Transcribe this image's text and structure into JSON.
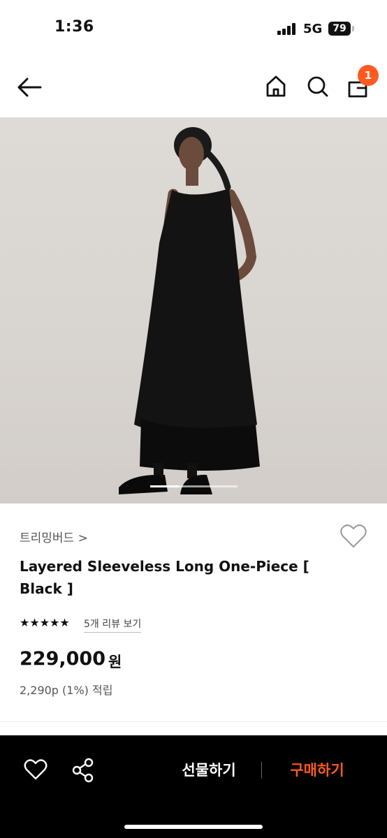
{
  "status_bar": {
    "time": "1:36",
    "network": "5G",
    "battery": "79"
  },
  "nav": {
    "cart_count": "1",
    "accent_color": "#ff5a1f"
  },
  "product": {
    "brand": "트리밍버드 >",
    "title": "Layered Sleeveless Long One-Piece [ Black ]",
    "rating_stars": "★★★★★",
    "rating_value": 5,
    "review_link": "5개 리뷰 보기",
    "price": "229,000",
    "price_unit": "원",
    "points": "2,290p (1%) 적립",
    "image_index": 1,
    "image_progress": 0.33
  },
  "bottom_bar": {
    "gift_label": "선물하기",
    "buy_label": "구매하기",
    "buy_color": "#ff5a1f"
  },
  "icons": [
    "back-arrow-icon",
    "home-icon",
    "search-icon",
    "shopping-bag-icon",
    "heart-icon",
    "share-icon"
  ]
}
